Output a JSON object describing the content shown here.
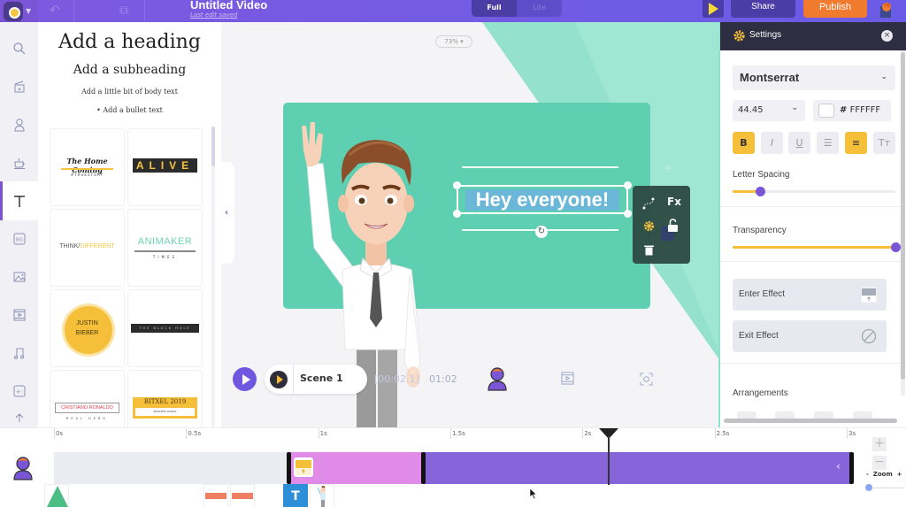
{
  "header": {
    "title": "Untitled Video",
    "subtitle": "Last edit saved",
    "modes": [
      "Full",
      "Lite"
    ],
    "active_mode": "Full",
    "share_label": "Share",
    "publish_label": "Publish",
    "colors": {
      "bar": "#6a5ce6",
      "publish": "#f07a2e",
      "play": "#f7d732"
    }
  },
  "rail": {
    "items": [
      {
        "icon": "search-icon"
      },
      {
        "icon": "scene-icon"
      },
      {
        "icon": "character-icon"
      },
      {
        "icon": "props-icon"
      },
      {
        "icon": "text-icon",
        "active": true
      },
      {
        "icon": "background-icon",
        "label": "BG"
      },
      {
        "icon": "image-icon"
      },
      {
        "icon": "video-icon"
      },
      {
        "icon": "music-icon"
      },
      {
        "icon": "effects-icon"
      },
      {
        "icon": "upload-icon"
      }
    ]
  },
  "text_panel": {
    "heading": "Add a heading",
    "subheading": "Add a subheading",
    "body": "Add a little bit of body text",
    "bullet": "• Add a bullet text",
    "templates": [
      {
        "title": "The Home Coming",
        "sub": "#TRUESTORY"
      },
      {
        "title": "ALIVE"
      },
      {
        "title": "THINK/",
        "title2": "DIFFERENT"
      },
      {
        "title": "ANIMAKER",
        "sub": "TIMES"
      },
      {
        "title": "JUSTIN",
        "title2": "BIEBER"
      },
      {
        "title": "THE BLACK HOLE"
      },
      {
        "title": "CRISTIANO RONALDO",
        "sub": "REAL HERO"
      },
      {
        "title": "BITXEL 2019",
        "sub": "BITSHEET PIXELS"
      }
    ]
  },
  "canvas": {
    "zoom": "73%",
    "selected_text": "Hey everyone!",
    "context_menu": {
      "fx": "Fx"
    },
    "card_color": "#5fcfb1"
  },
  "playbar": {
    "scene_label": "Scene 1",
    "current_time": "[00:02.1]",
    "total_time": "01:02"
  },
  "settings": {
    "title": "Settings",
    "font": "Montserrat",
    "font_size": "44.45",
    "color_hash": "#",
    "color_hex": "FFFFFF",
    "format_buttons": [
      {
        "label": "B",
        "name": "bold",
        "active": true
      },
      {
        "label": "I",
        "name": "italic",
        "active": false
      },
      {
        "label": "U",
        "name": "underline",
        "active": false
      },
      {
        "label": "☰",
        "name": "list",
        "active": false
      },
      {
        "label": "≡",
        "name": "align-center",
        "active": true
      },
      {
        "label": "Tт",
        "name": "text-case",
        "active": false
      }
    ],
    "letter_spacing_label": "Letter Spacing",
    "letter_spacing_value": 0.17,
    "transparency_label": "Transparency",
    "transparency_value": 1.0,
    "enter_effect_label": "Enter Effect",
    "exit_effect_label": "Exit Effect",
    "arrangements_label": "Arrangements"
  },
  "timeline": {
    "ticks": [
      "0s",
      "0.5s",
      "1s",
      "1.5s",
      "2s",
      "2.5s",
      "3s"
    ],
    "playhead_seconds": 2.1,
    "zoom_label": "Zoom",
    "zoom_minus": "-",
    "zoom_plus": "+",
    "clip_colors": {
      "idle": "#e9ecf0",
      "enter": "#e18be8",
      "main": "#8764da"
    }
  }
}
